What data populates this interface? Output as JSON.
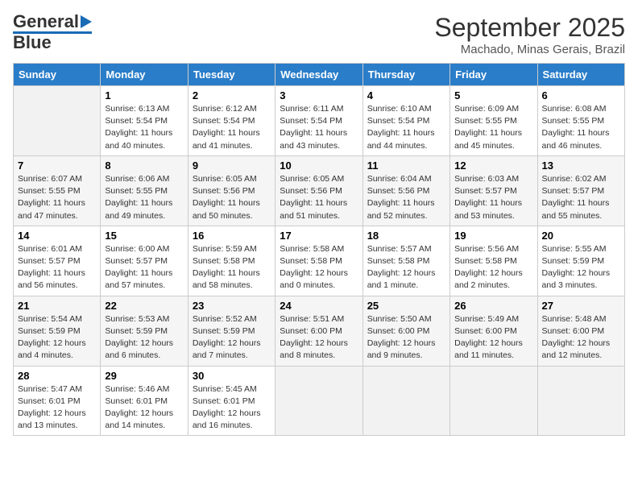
{
  "header": {
    "logo_general": "General",
    "logo_blue": "Blue",
    "month": "September 2025",
    "location": "Machado, Minas Gerais, Brazil"
  },
  "days_of_week": [
    "Sunday",
    "Monday",
    "Tuesday",
    "Wednesday",
    "Thursday",
    "Friday",
    "Saturday"
  ],
  "weeks": [
    [
      {
        "day": "",
        "empty": true
      },
      {
        "day": "1",
        "sunrise": "6:13 AM",
        "sunset": "5:54 PM",
        "daylight": "11 hours and 40 minutes."
      },
      {
        "day": "2",
        "sunrise": "6:12 AM",
        "sunset": "5:54 PM",
        "daylight": "11 hours and 41 minutes."
      },
      {
        "day": "3",
        "sunrise": "6:11 AM",
        "sunset": "5:54 PM",
        "daylight": "11 hours and 43 minutes."
      },
      {
        "day": "4",
        "sunrise": "6:10 AM",
        "sunset": "5:54 PM",
        "daylight": "11 hours and 44 minutes."
      },
      {
        "day": "5",
        "sunrise": "6:09 AM",
        "sunset": "5:55 PM",
        "daylight": "11 hours and 45 minutes."
      },
      {
        "day": "6",
        "sunrise": "6:08 AM",
        "sunset": "5:55 PM",
        "daylight": "11 hours and 46 minutes."
      }
    ],
    [
      {
        "day": "7",
        "sunrise": "6:07 AM",
        "sunset": "5:55 PM",
        "daylight": "11 hours and 47 minutes."
      },
      {
        "day": "8",
        "sunrise": "6:06 AM",
        "sunset": "5:55 PM",
        "daylight": "11 hours and 49 minutes."
      },
      {
        "day": "9",
        "sunrise": "6:05 AM",
        "sunset": "5:56 PM",
        "daylight": "11 hours and 50 minutes."
      },
      {
        "day": "10",
        "sunrise": "6:05 AM",
        "sunset": "5:56 PM",
        "daylight": "11 hours and 51 minutes."
      },
      {
        "day": "11",
        "sunrise": "6:04 AM",
        "sunset": "5:56 PM",
        "daylight": "11 hours and 52 minutes."
      },
      {
        "day": "12",
        "sunrise": "6:03 AM",
        "sunset": "5:57 PM",
        "daylight": "11 hours and 53 minutes."
      },
      {
        "day": "13",
        "sunrise": "6:02 AM",
        "sunset": "5:57 PM",
        "daylight": "11 hours and 55 minutes."
      }
    ],
    [
      {
        "day": "14",
        "sunrise": "6:01 AM",
        "sunset": "5:57 PM",
        "daylight": "11 hours and 56 minutes."
      },
      {
        "day": "15",
        "sunrise": "6:00 AM",
        "sunset": "5:57 PM",
        "daylight": "11 hours and 57 minutes."
      },
      {
        "day": "16",
        "sunrise": "5:59 AM",
        "sunset": "5:58 PM",
        "daylight": "11 hours and 58 minutes."
      },
      {
        "day": "17",
        "sunrise": "5:58 AM",
        "sunset": "5:58 PM",
        "daylight": "12 hours and 0 minutes."
      },
      {
        "day": "18",
        "sunrise": "5:57 AM",
        "sunset": "5:58 PM",
        "daylight": "12 hours and 1 minute."
      },
      {
        "day": "19",
        "sunrise": "5:56 AM",
        "sunset": "5:58 PM",
        "daylight": "12 hours and 2 minutes."
      },
      {
        "day": "20",
        "sunrise": "5:55 AM",
        "sunset": "5:59 PM",
        "daylight": "12 hours and 3 minutes."
      }
    ],
    [
      {
        "day": "21",
        "sunrise": "5:54 AM",
        "sunset": "5:59 PM",
        "daylight": "12 hours and 4 minutes."
      },
      {
        "day": "22",
        "sunrise": "5:53 AM",
        "sunset": "5:59 PM",
        "daylight": "12 hours and 6 minutes."
      },
      {
        "day": "23",
        "sunrise": "5:52 AM",
        "sunset": "5:59 PM",
        "daylight": "12 hours and 7 minutes."
      },
      {
        "day": "24",
        "sunrise": "5:51 AM",
        "sunset": "6:00 PM",
        "daylight": "12 hours and 8 minutes."
      },
      {
        "day": "25",
        "sunrise": "5:50 AM",
        "sunset": "6:00 PM",
        "daylight": "12 hours and 9 minutes."
      },
      {
        "day": "26",
        "sunrise": "5:49 AM",
        "sunset": "6:00 PM",
        "daylight": "12 hours and 11 minutes."
      },
      {
        "day": "27",
        "sunrise": "5:48 AM",
        "sunset": "6:00 PM",
        "daylight": "12 hours and 12 minutes."
      }
    ],
    [
      {
        "day": "28",
        "sunrise": "5:47 AM",
        "sunset": "6:01 PM",
        "daylight": "12 hours and 13 minutes."
      },
      {
        "day": "29",
        "sunrise": "5:46 AM",
        "sunset": "6:01 PM",
        "daylight": "12 hours and 14 minutes."
      },
      {
        "day": "30",
        "sunrise": "5:45 AM",
        "sunset": "6:01 PM",
        "daylight": "12 hours and 16 minutes."
      },
      {
        "day": "",
        "empty": true
      },
      {
        "day": "",
        "empty": true
      },
      {
        "day": "",
        "empty": true
      },
      {
        "day": "",
        "empty": true
      }
    ]
  ],
  "labels": {
    "sunrise": "Sunrise:",
    "sunset": "Sunset:",
    "daylight": "Daylight:"
  }
}
